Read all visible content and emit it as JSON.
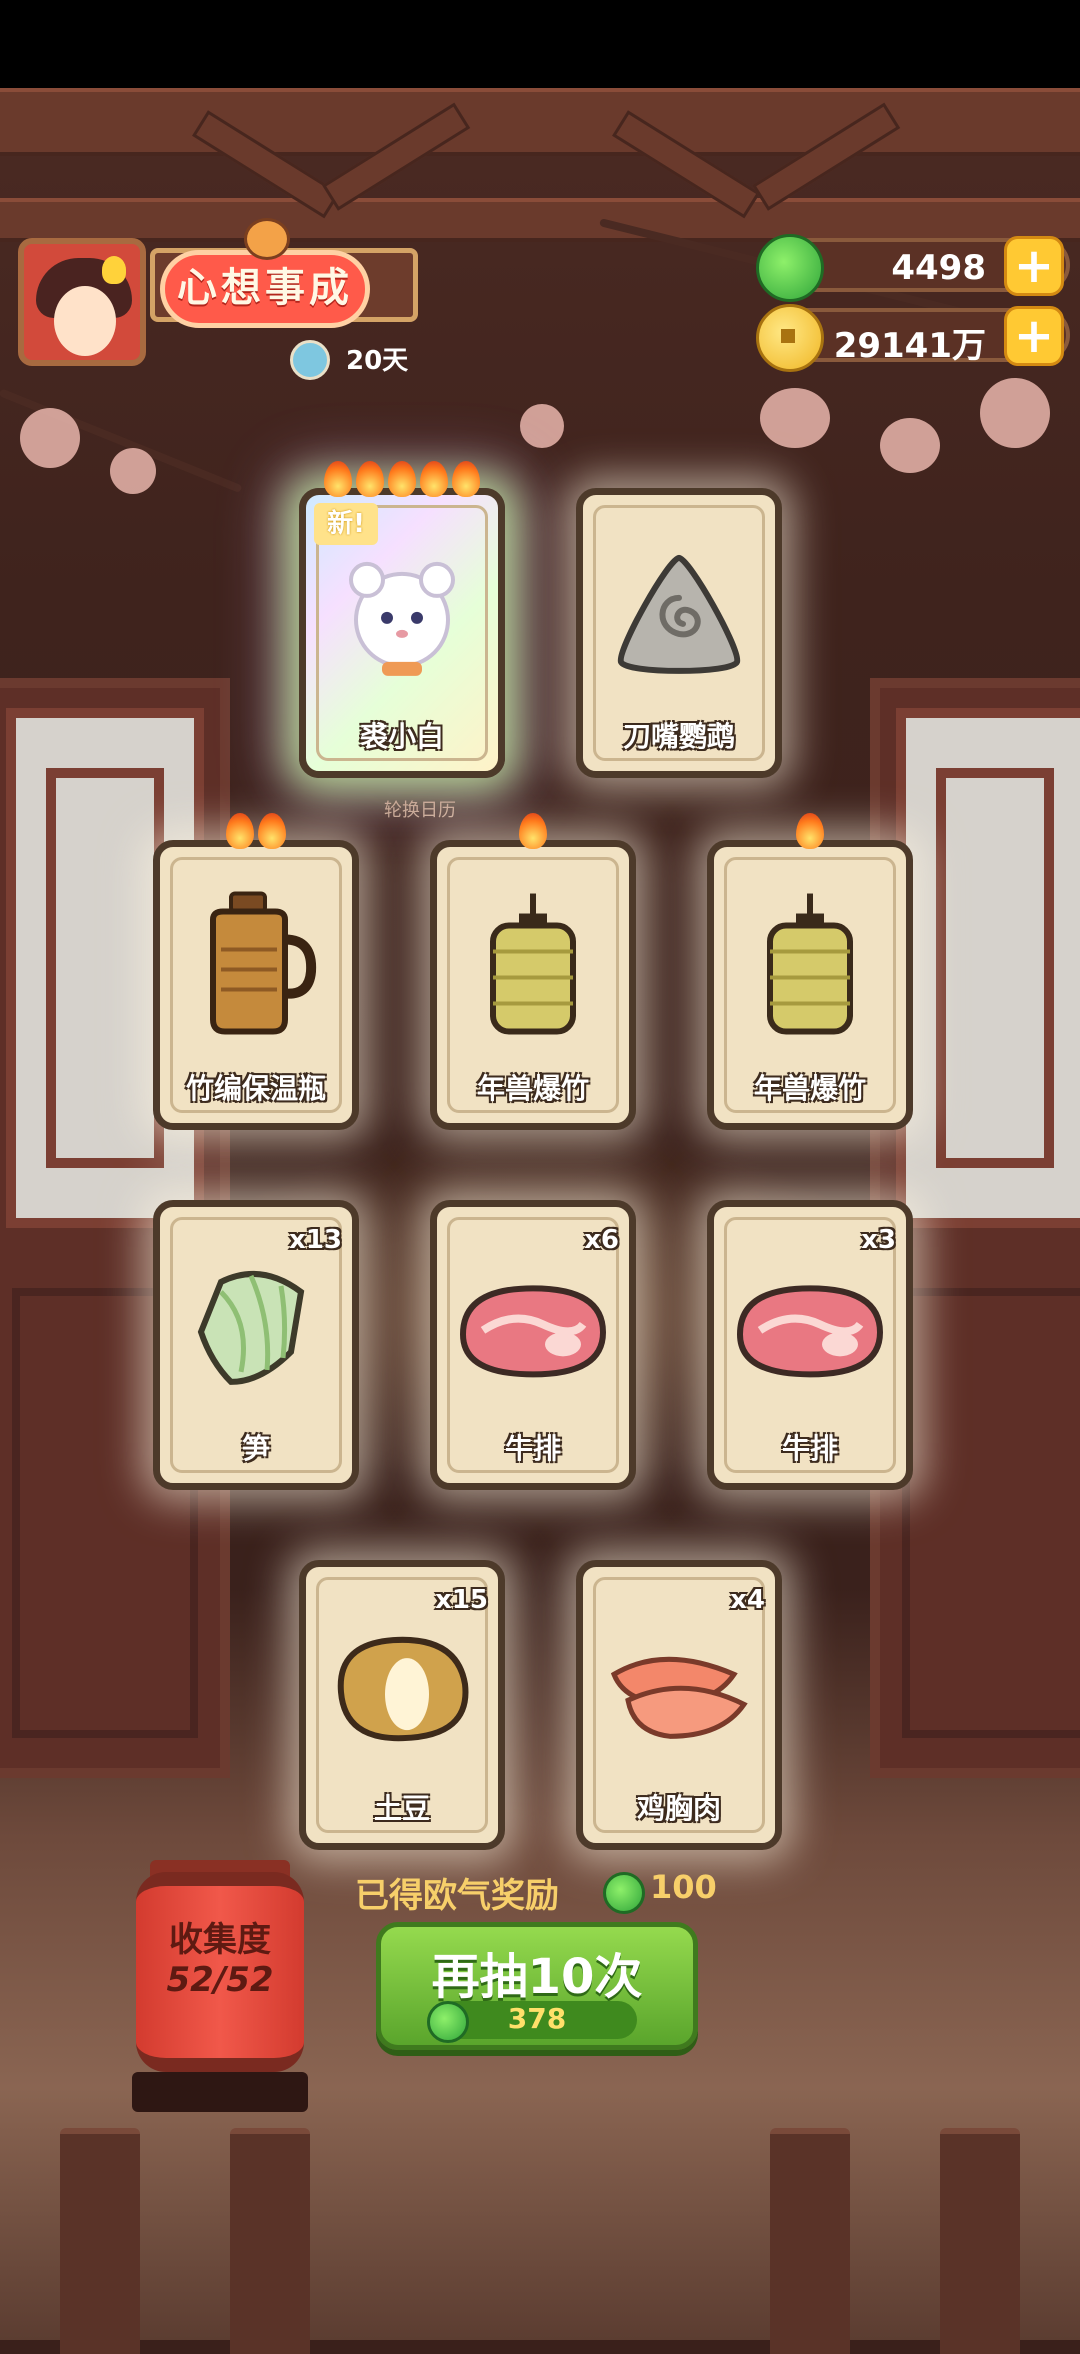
{
  "header": {
    "title_badge": "心想事成",
    "days_remaining": "20天"
  },
  "currency": {
    "jade": "4498",
    "coins": "29141万"
  },
  "calendar_caption": "轮换日历",
  "cards": [
    {
      "name": "裘小白",
      "qty": "",
      "flames": 5,
      "is_new": true,
      "new_label": "新!",
      "icon": "white-cat-icon"
    },
    {
      "name": "刀嘴鹦鹉",
      "qty": "",
      "flames": 0,
      "is_new": false,
      "icon": "stone-rune-icon"
    },
    {
      "name": "竹编保温瓶",
      "qty": "",
      "flames": 2,
      "is_new": false,
      "icon": "thermos-icon"
    },
    {
      "name": "年兽爆竹",
      "qty": "",
      "flames": 1,
      "is_new": false,
      "icon": "firecracker-icon"
    },
    {
      "name": "年兽爆竹",
      "qty": "",
      "flames": 1,
      "is_new": false,
      "icon": "firecracker-icon"
    },
    {
      "name": "笋",
      "qty": "x13",
      "flames": 0,
      "is_new": false,
      "icon": "bamboo-shoot-icon"
    },
    {
      "name": "牛排",
      "qty": "x6",
      "flames": 0,
      "is_new": false,
      "icon": "steak-icon"
    },
    {
      "name": "牛排",
      "qty": "x3",
      "flames": 0,
      "is_new": false,
      "icon": "steak-icon"
    },
    {
      "name": "土豆",
      "qty": "x15",
      "flames": 0,
      "is_new": false,
      "icon": "potato-icon"
    },
    {
      "name": "鸡胸肉",
      "qty": "x4",
      "flames": 0,
      "is_new": false,
      "icon": "chicken-breast-icon"
    }
  ],
  "bonus": {
    "label": "已得欧气奖励",
    "amount": "100"
  },
  "draw_button": {
    "label": "再抽10次",
    "cost": "378"
  },
  "collection": {
    "title": "收集度",
    "count": "52/52"
  },
  "colors": {
    "jade": "#3fb63f",
    "gold": "#f7cf6a",
    "button_green": "#6cb936",
    "title_red": "#ff5a4a"
  }
}
